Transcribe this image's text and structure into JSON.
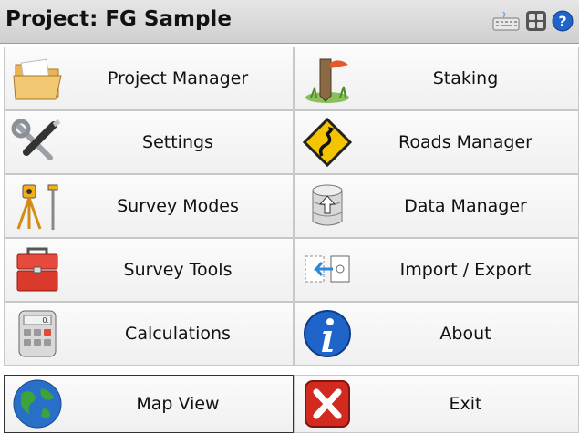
{
  "header": {
    "title": "Project: FG Sample",
    "icons": [
      "keyboard-icon",
      "calculator-icon",
      "help-icon"
    ]
  },
  "menu": {
    "tiles": [
      {
        "label": "Project Manager",
        "icon": "folder-icon"
      },
      {
        "label": "Staking",
        "icon": "stake-icon"
      },
      {
        "label": "Settings",
        "icon": "tools-icon"
      },
      {
        "label": "Roads Manager",
        "icon": "road-sign-icon"
      },
      {
        "label": "Survey Modes",
        "icon": "total-station-icon"
      },
      {
        "label": "Data Manager",
        "icon": "database-icon"
      },
      {
        "label": "Survey Tools",
        "icon": "toolbox-icon"
      },
      {
        "label": "Import / Export",
        "icon": "import-export-icon"
      },
      {
        "label": "Calculations",
        "icon": "calculator-icon"
      },
      {
        "label": "About",
        "icon": "info-icon"
      },
      {
        "label": "Map View",
        "icon": "globe-icon"
      },
      {
        "label": "Exit",
        "icon": "exit-icon"
      }
    ]
  },
  "colors": {
    "titlebar": "#d9d9d9",
    "tile_bg": "#f5f5f5",
    "info_blue": "#1f64c8",
    "exit_red": "#d22a1e",
    "road_sign_yellow": "#f5c400"
  }
}
